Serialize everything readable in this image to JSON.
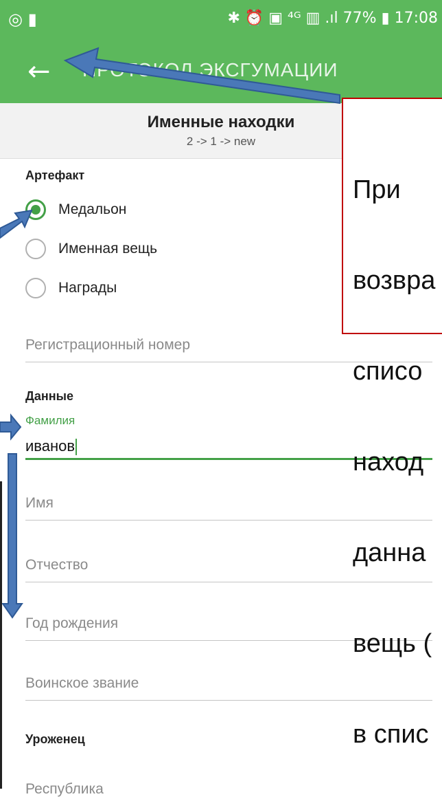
{
  "status_bar": {
    "left_icons": "◎ ▮",
    "right_text": "✱ ⏰ ▣ ⁴ᴳ ▥ .ıl 77% ▮ 17:08",
    "battery": "77%",
    "time": "17:08"
  },
  "app_bar": {
    "back_icon": "arrow-left-icon",
    "title": "ПРОТОКОЛ ЭКСГУМАЦИИ",
    "background": "#5cb85c"
  },
  "subheader": {
    "title": "Именные находки",
    "path": "2 -> 1 -> new"
  },
  "artifact": {
    "label": "Артефакт",
    "options": [
      {
        "label": "Медальон",
        "selected": true
      },
      {
        "label": "Именная вещь",
        "selected": false
      },
      {
        "label": "Награды",
        "selected": false
      }
    ]
  },
  "registration": {
    "placeholder": "Регистрационный номер"
  },
  "data_section": {
    "label": "Данные",
    "surname_label": "Фамилия",
    "surname_value": "иванов",
    "first_name_placeholder": "Имя",
    "patronymic_placeholder": "Отчество",
    "birth_year_placeholder": "Год рождения",
    "rank_placeholder": "Воинское звание"
  },
  "origin_section": {
    "label": "Уроженец",
    "republic_placeholder": "Республика"
  },
  "annotation": {
    "text_lines": [
      "При",
      "возвра",
      "списо",
      "наход",
      "данна",
      "вещь (",
      "в спис"
    ],
    "border_color": "#c00000",
    "arrow_color": "#4a78b8"
  }
}
